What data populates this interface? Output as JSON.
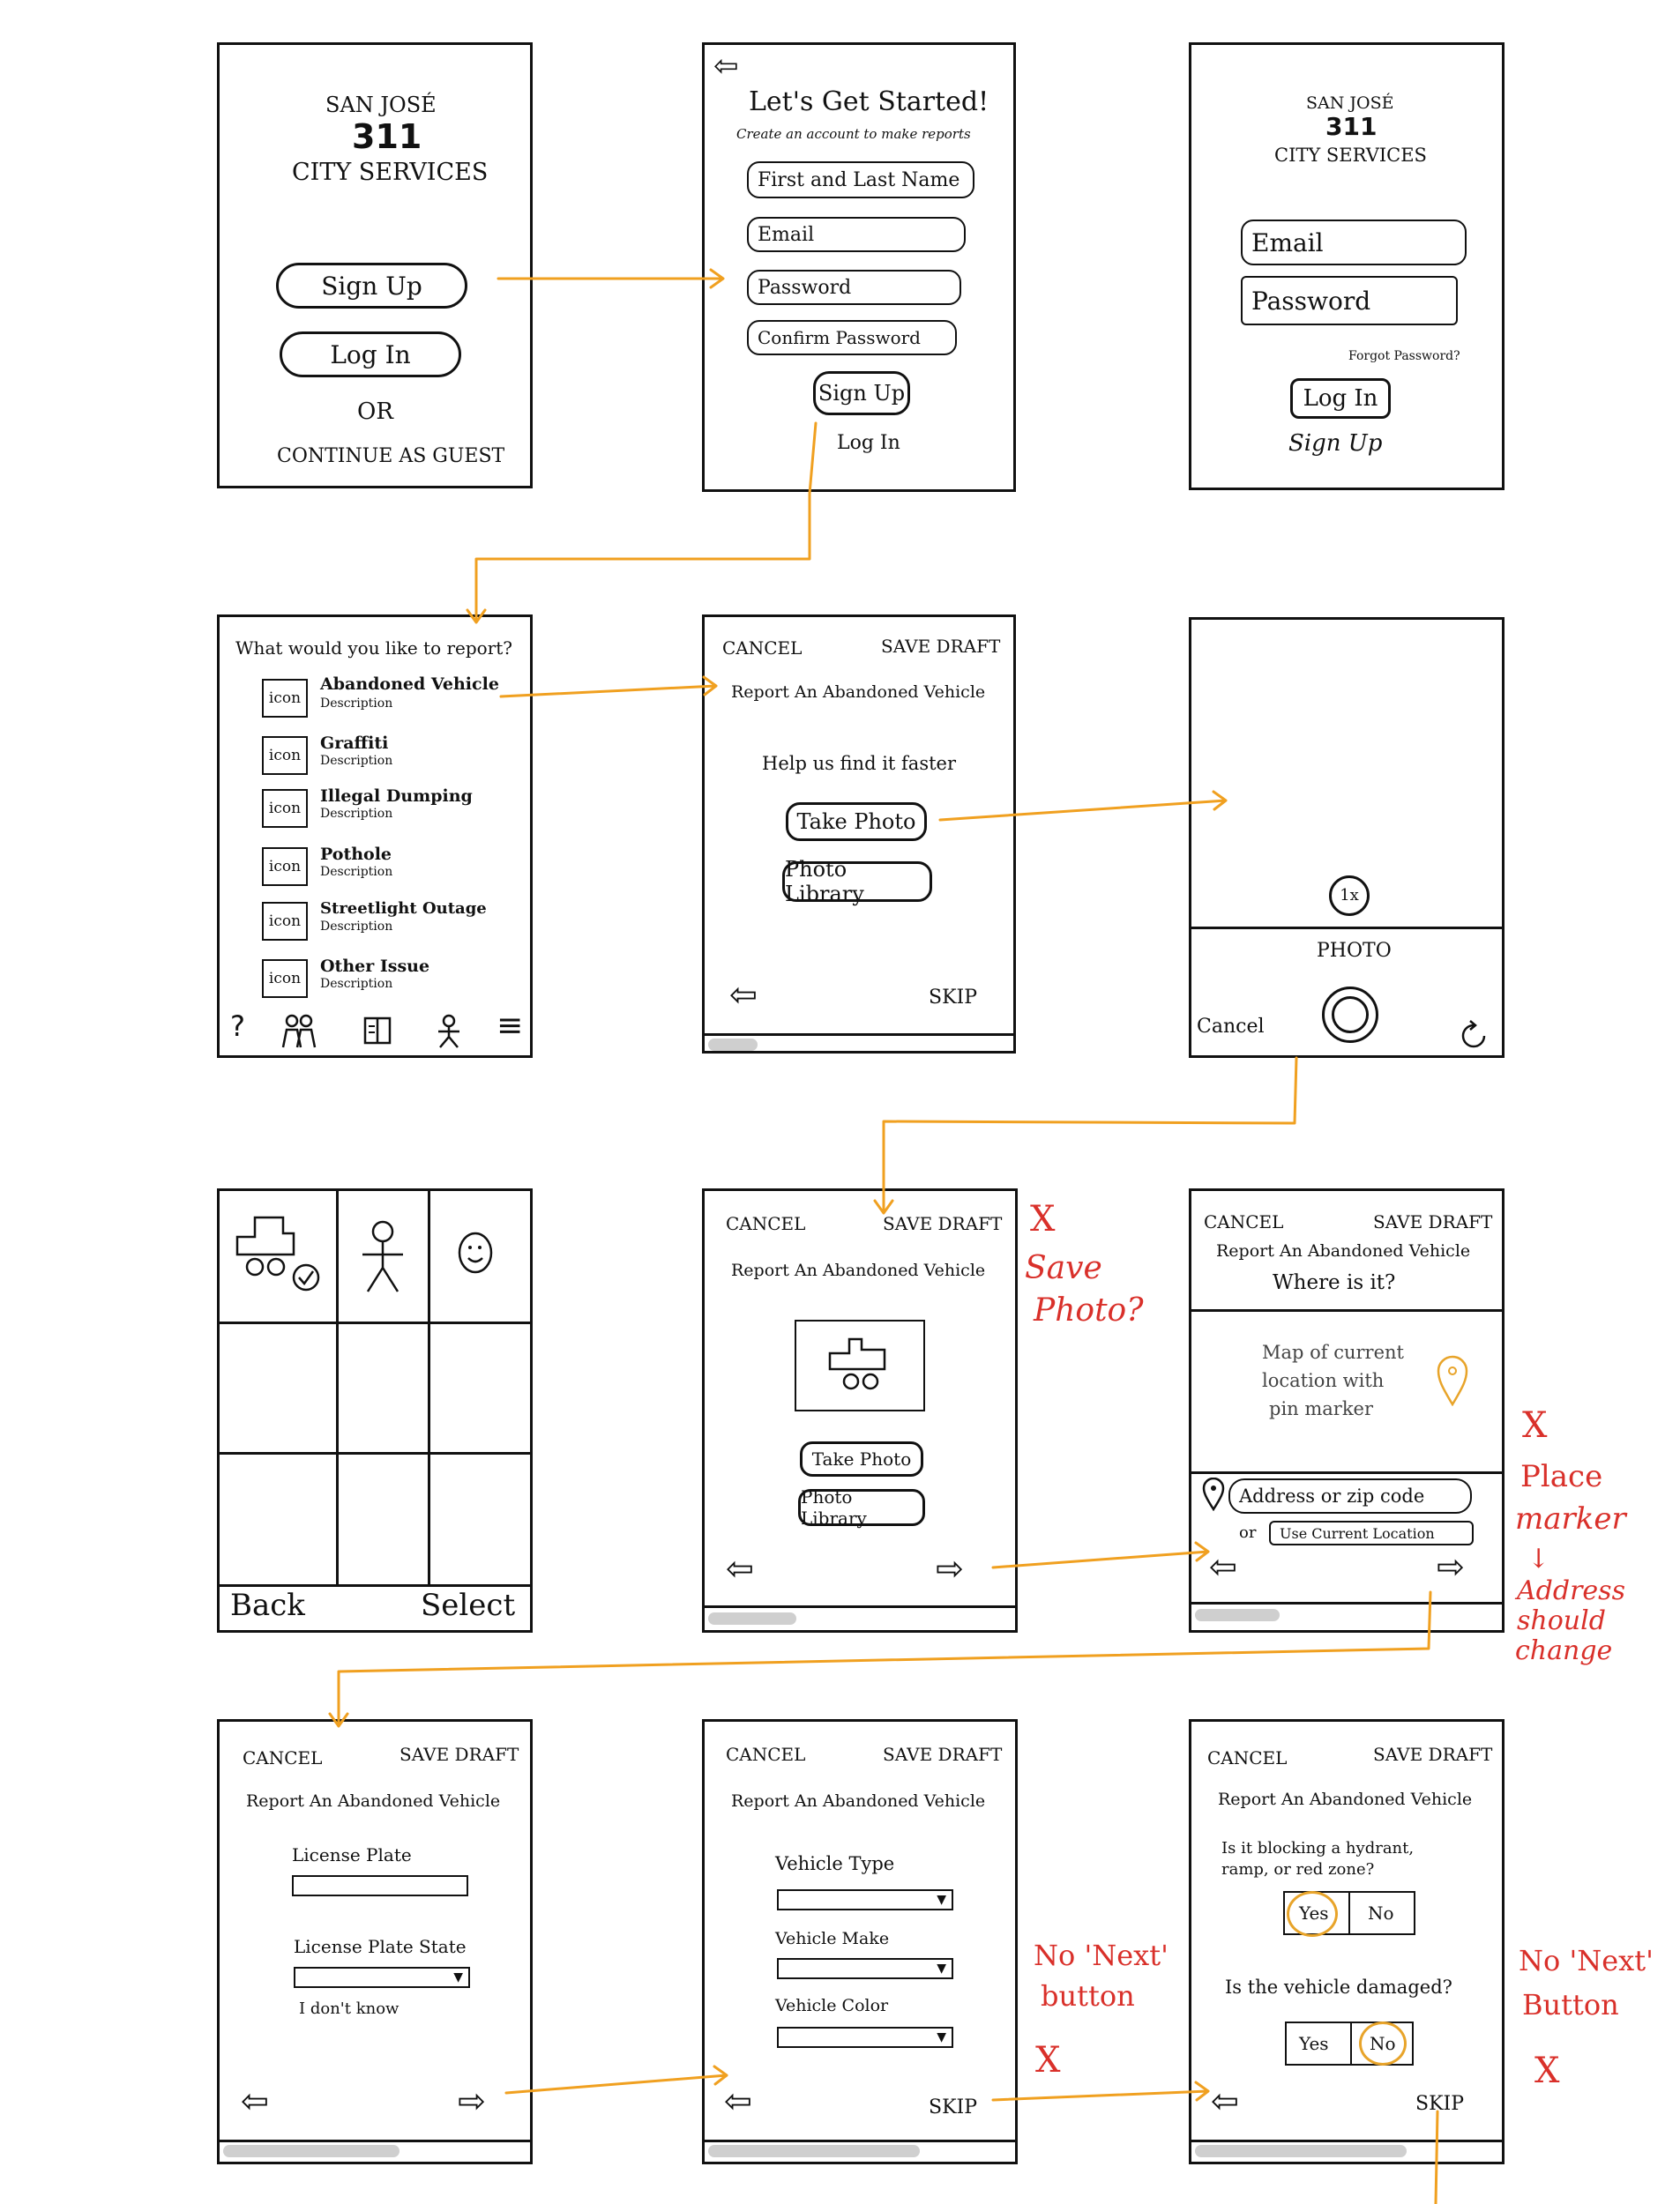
{
  "screen1": {
    "brand_top": "SAN JOSÉ",
    "brand_number": "311",
    "brand_bottom": "CITY SERVICES",
    "signup_button": "Sign Up",
    "login_button": "Log In",
    "or_text": "OR",
    "guest_link": "CONTINUE AS GUEST"
  },
  "screen2": {
    "back_icon": "back-arrow-icon",
    "title": "Let's Get Started!",
    "subtitle": "Create an account to make reports",
    "name_field": "First and Last Name",
    "email_field": "Email",
    "password_field": "Password",
    "confirm_field": "Confirm Password",
    "signup_button": "Sign Up",
    "login_link": "Log In"
  },
  "screen3": {
    "brand_top": "SAN JOSÉ",
    "brand_number": "311",
    "brand_bottom": "CITY SERVICES",
    "email_field": "Email",
    "password_field": "Password",
    "forgot_link": "Forgot Password?",
    "login_button": "Log In",
    "signup_link": "Sign Up"
  },
  "screen4": {
    "heading": "What would you like to report?",
    "icon_label": "icon",
    "desc_label": "Description",
    "items": [
      {
        "label": "Abandoned Vehicle"
      },
      {
        "label": "Graffiti"
      },
      {
        "label": "Illegal Dumping"
      },
      {
        "label": "Pothole"
      },
      {
        "label": "Streetlight Outage"
      },
      {
        "label": "Other Issue"
      }
    ],
    "tabbar": [
      "help-icon",
      "people-icon",
      "book-icon",
      "person-icon",
      "menu-icon"
    ],
    "help_glyph": "?",
    "menu_glyph": "≡"
  },
  "screen5": {
    "cancel": "CANCEL",
    "save_draft": "SAVE DRAFT",
    "title": "Report An Abandoned Vehicle",
    "prompt": "Help us find it faster",
    "take_photo": "Take Photo",
    "photo_library": "Photo Library",
    "skip": "SKIP"
  },
  "screen6": {
    "zoom": "1x",
    "mode": "PHOTO",
    "cancel": "Cancel"
  },
  "screen7": {
    "back": "Back",
    "select": "Select"
  },
  "screen8": {
    "cancel": "CANCEL",
    "save_draft": "SAVE DRAFT",
    "title": "Report An Abandoned Vehicle",
    "take_photo": "Take Photo",
    "photo_library": "Photo Library"
  },
  "screen9": {
    "cancel": "CANCEL",
    "save_draft": "SAVE DRAFT",
    "title": "Report An Abandoned Vehicle",
    "question": "Where is it?",
    "map_text_1": "Map of current",
    "map_text_2": "location with",
    "map_text_3": "pin marker",
    "address_field": "Address or zip code",
    "or_text": "or",
    "use_location": "Use Current Location"
  },
  "screen10": {
    "cancel": "CANCEL",
    "save_draft": "SAVE DRAFT",
    "title": "Report An Abandoned Vehicle",
    "plate_label": "License Plate",
    "state_label": "License Plate State",
    "dont_know": "I don't know"
  },
  "screen11": {
    "cancel": "CANCEL",
    "save_draft": "SAVE DRAFT",
    "title": "Report An Abandoned Vehicle",
    "type_label": "Vehicle Type",
    "make_label": "Vehicle Make",
    "color_label": "Vehicle Color",
    "skip": "SKIP"
  },
  "screen12": {
    "cancel": "CANCEL",
    "save_draft": "SAVE DRAFT",
    "title": "Report An Abandoned Vehicle",
    "q1_line1": "Is it blocking a hydrant,",
    "q1_line2": "ramp, or red zone?",
    "yes": "Yes",
    "no": "No",
    "q2": "Is the vehicle damaged?",
    "skip": "SKIP"
  },
  "notes": {
    "mark": "X",
    "save_photo_1": "Save",
    "save_photo_2": "Photo?",
    "place_marker_1": "Place",
    "place_marker_2": "marker",
    "down_arrow": "↓",
    "address_1": "Address",
    "address_2": "should",
    "address_3": "change",
    "no_next_1a": "No 'Next'",
    "no_next_1b": "button",
    "no_next_2a": "No 'Next'",
    "no_next_2b": "Button"
  },
  "colors": {
    "flow_arrow": "#f0a020",
    "annotation": "#d9302a",
    "ink": "#111111",
    "home_bar": "#cfcfcf"
  }
}
